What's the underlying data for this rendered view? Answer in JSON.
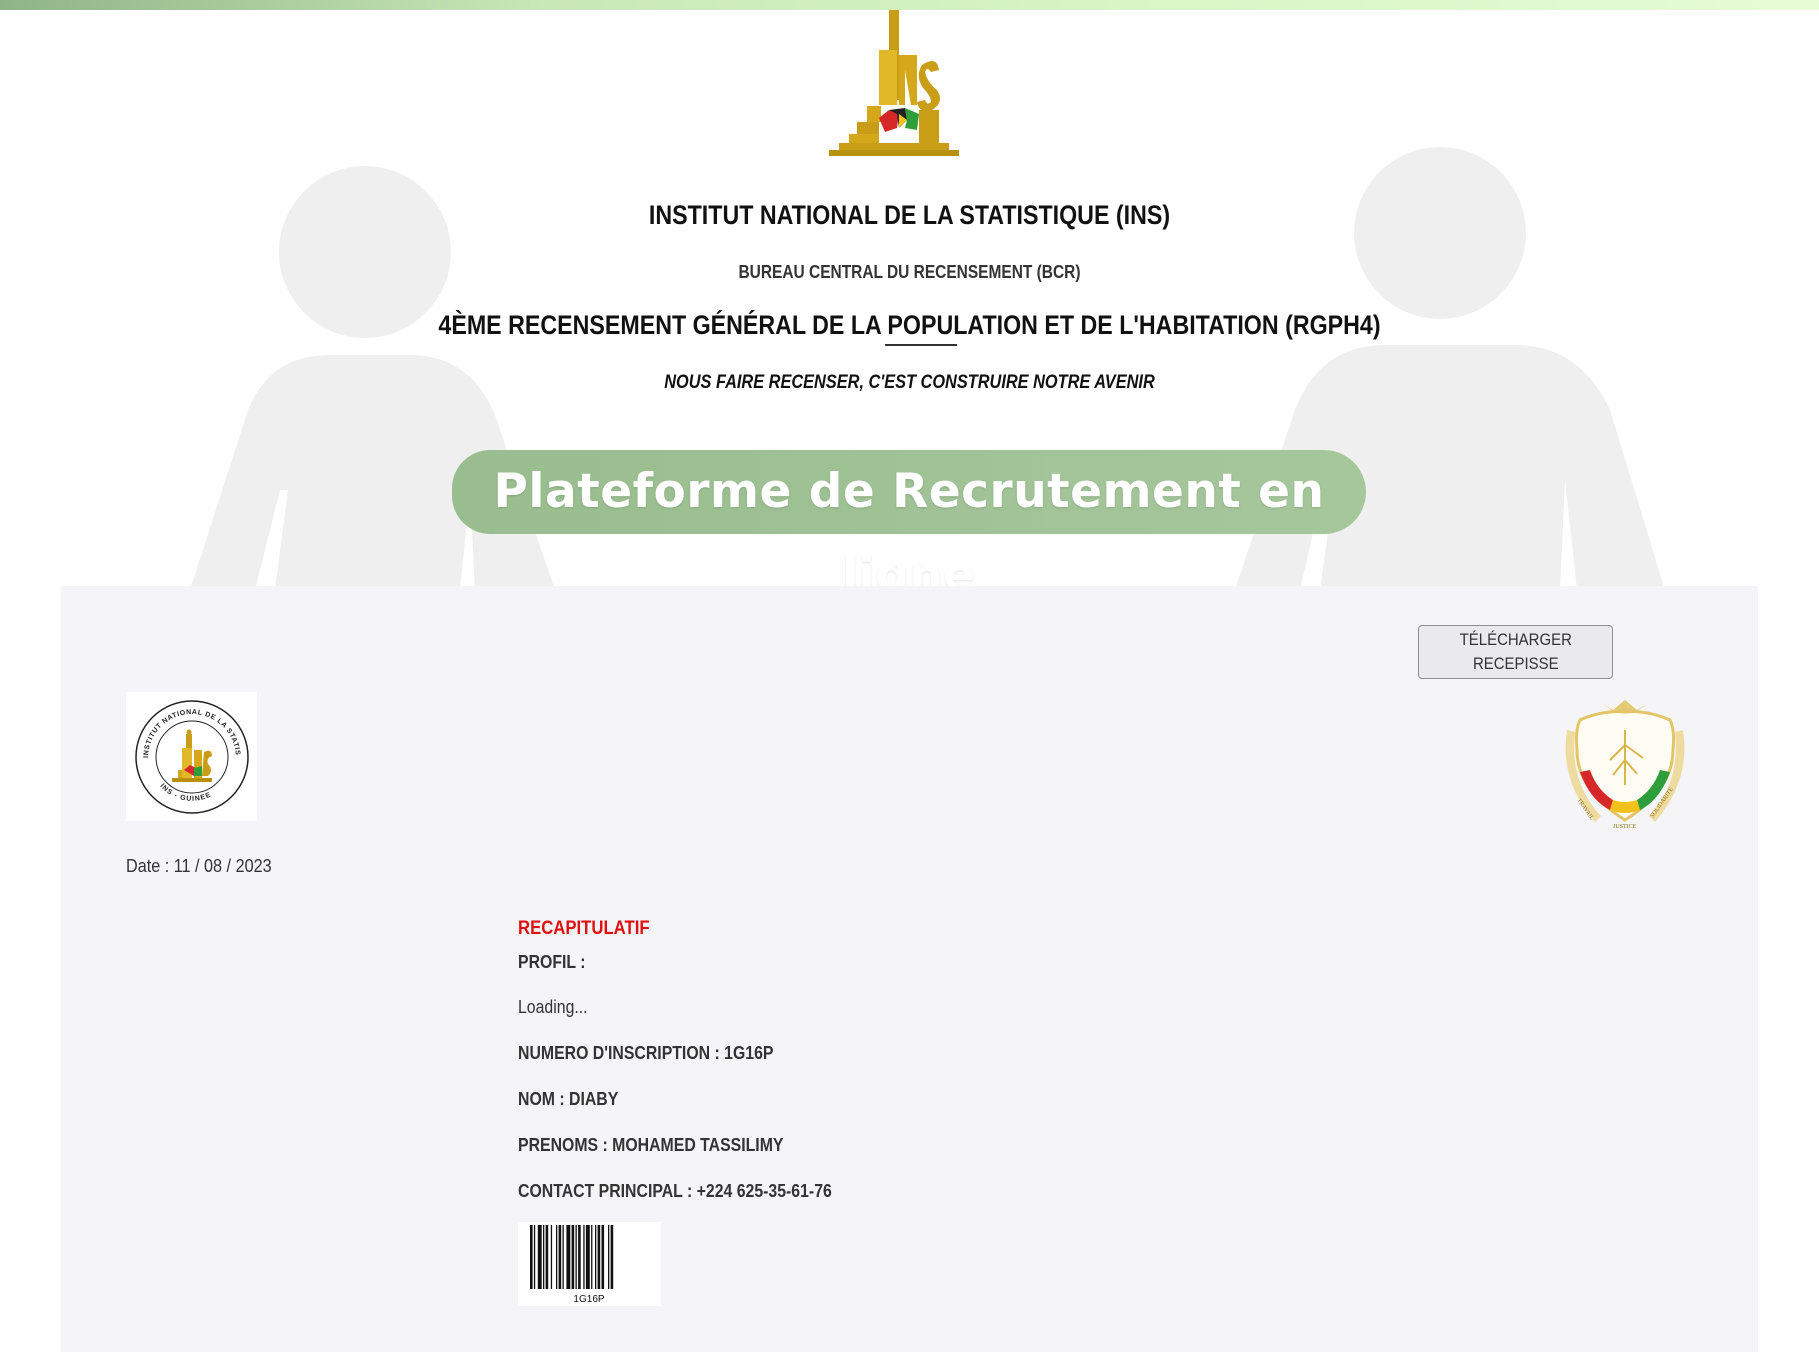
{
  "colors": {
    "top_bar": "#c9e8b8",
    "banner": "#a3c499",
    "panel_bg": "#f5f5f7",
    "recap_title": "#e01010"
  },
  "header": {
    "logo_icon": "ins-logo-icon",
    "institute": "INSTITUT NATIONAL DE LA STATISTIQUE (INS)",
    "bureau": "BUREAU CENTRAL DU RECENSEMENT (BCR)",
    "census": "4ÈME RECENSEMENT GÉNÉRAL DE LA POPULATION ET DE L'HABITATION (RGPH4)",
    "slogan": "NOUS FAIRE RECENSER, C'EST CONSTRUIRE NOTRE AVENIR"
  },
  "banner": {
    "text": "Plateforme de Recrutement en ligne"
  },
  "receipt": {
    "download_line1": "TÉLÉCHARGER",
    "download_line2": "RECEPISSE",
    "seal_icon": "ins-guinee-seal-icon",
    "seal_text_top": "INSTITUT NATIONAL DE LA STATISTIQUE",
    "seal_text_bottom": "INS - GUINEE",
    "coat_icon": "guinea-coat-of-arms-icon",
    "coat_motto": [
      "TRAVAIL",
      "JUSTICE",
      "SOLIDARITE"
    ],
    "date_label": "Date : 11 / 08 / 2023",
    "recap_title": "RECAPITULATIF",
    "profil_label": "PROFIL :",
    "profil_value": "Loading...",
    "inscription": "NUMERO D'INSCRIPTION : 1G16P",
    "nom": "NOM : DIABY",
    "prenoms": "PRENOMS : MOHAMED TASSILIMY",
    "contact": "CONTACT PRINCIPAL : +224 625-35-61-76",
    "barcode_icon": "barcode-icon",
    "barcode_text": "1G16P"
  }
}
